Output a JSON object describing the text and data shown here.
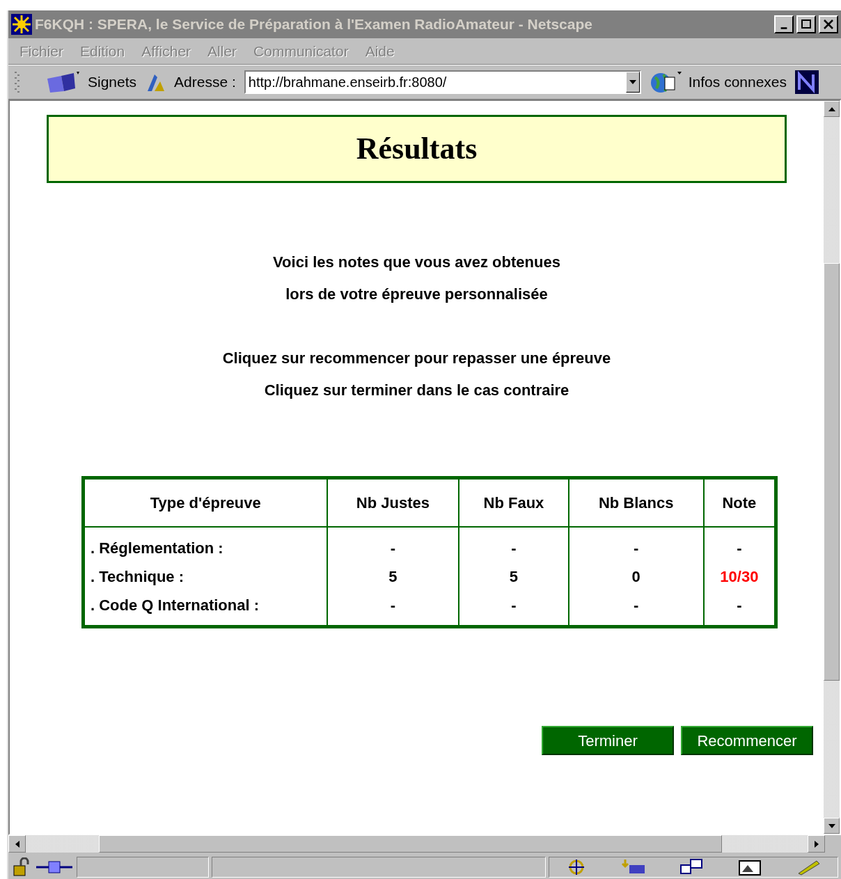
{
  "window": {
    "title": "F6KQH : SPERA, le Service de Préparation à l'Examen RadioAmateur - Netscape",
    "active": false
  },
  "menu": [
    {
      "label": "Fichier",
      "disabled": true
    },
    {
      "label": "Edition",
      "disabled": true
    },
    {
      "label": "Afficher",
      "disabled": true
    },
    {
      "label": "Aller",
      "disabled": true
    },
    {
      "label": "Communicator",
      "disabled": true
    },
    {
      "label": "Aide",
      "disabled": true
    }
  ],
  "toolbar": {
    "bookmarks": "Signets",
    "address_label": "Adresse :",
    "address": "http://brahmane.enseirb.fr:8080/",
    "related": "Infos connexes"
  },
  "page": {
    "heading": "Résultats",
    "intro": [
      "Voici les notes que vous avez obtenues",
      "lors de votre épreuve personnalisée"
    ],
    "instructions": [
      "Cliquez sur recommencer pour repasser une épreuve",
      "Cliquez sur terminer dans le cas contraire"
    ],
    "table": {
      "columns": [
        "Type d'épreuve",
        "Nb Justes",
        "Nb Faux",
        "Nb Blancs",
        "Note"
      ],
      "rows": [
        {
          "cells": [
            ". Réglementation :",
            "-",
            "-",
            "-",
            "-"
          ],
          "failed": false
        },
        {
          "cells": [
            ". Technique :",
            "5",
            "5",
            "0",
            "10/30"
          ],
          "failed": true
        },
        {
          "cells": [
            ". Code Q International :",
            "-",
            "-",
            "-",
            "-"
          ],
          "failed": false
        }
      ]
    },
    "buttons": [
      "Terminer",
      "Recommencer"
    ]
  }
}
